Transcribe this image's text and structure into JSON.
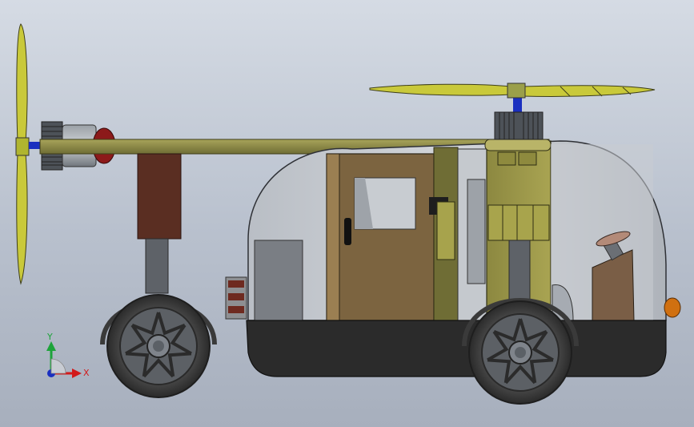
{
  "triad": {
    "y_label": "Y",
    "x_label": "X"
  },
  "colors": {
    "background_top": "#d5dbe4",
    "background_bottom": "#a7afbd",
    "propeller": "#c9c93a",
    "boom": "#8c8a45",
    "body_shell": "#c3c7cc",
    "door": "#7c6440",
    "hull": "#2b2b2b",
    "gear_column": "#5a2e22",
    "tire": "#3a3a3a",
    "hub": "#7f848b",
    "indicator": "#d07010",
    "axis_y": "#1da33a",
    "axis_x": "#d21a1a",
    "axis_z": "#1a2fc0"
  }
}
